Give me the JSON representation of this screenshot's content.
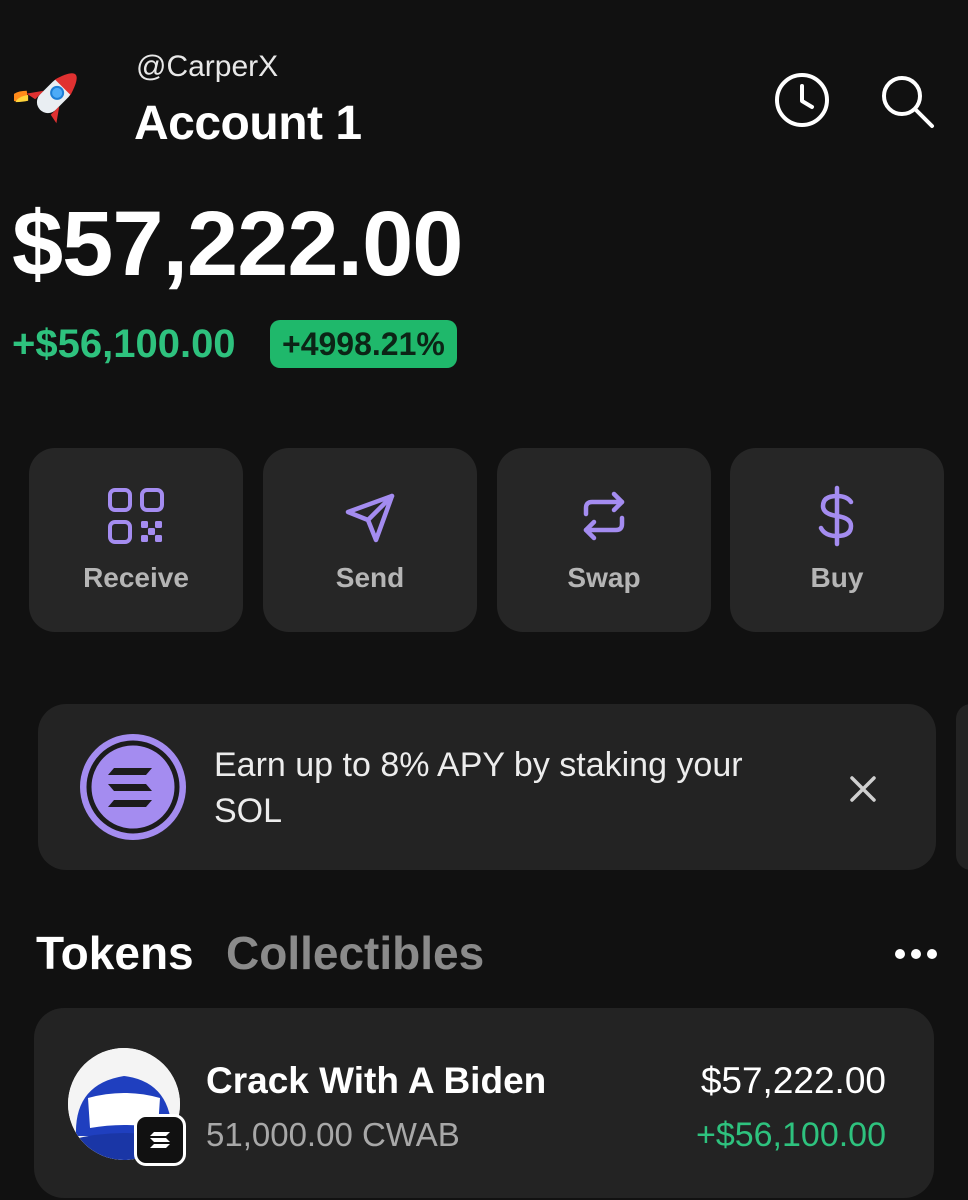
{
  "header": {
    "handle": "@CarperX",
    "account_name": "Account 1",
    "avatar_icon": "rocket-icon",
    "history_icon": "clock-icon",
    "search_icon": "search-icon"
  },
  "balance": {
    "total": "$57,222.00",
    "change_amount": "+$56,100.00",
    "change_percent": "+4998.21%"
  },
  "actions": [
    {
      "label": "Receive",
      "icon": "qr-code-icon"
    },
    {
      "label": "Send",
      "icon": "paper-plane-icon"
    },
    {
      "label": "Swap",
      "icon": "swap-arrows-icon"
    },
    {
      "label": "Buy",
      "icon": "dollar-icon"
    }
  ],
  "banner": {
    "text": "Earn up to 8% APY by staking your SOL",
    "icon": "solana-icon",
    "close_icon": "close-icon"
  },
  "tabs": [
    {
      "label": "Tokens",
      "active": true
    },
    {
      "label": "Collectibles",
      "active": false
    }
  ],
  "tokens": [
    {
      "name": "Crack With A Biden",
      "amount": "51,000.00 CWAB",
      "value": "$57,222.00",
      "change": "+$56,100.00",
      "icon_text": "Crack With A Biden"
    }
  ],
  "colors": {
    "accent": "#a48cf0",
    "positive": "#2ec27e",
    "background": "#111111",
    "card": "#262626"
  }
}
